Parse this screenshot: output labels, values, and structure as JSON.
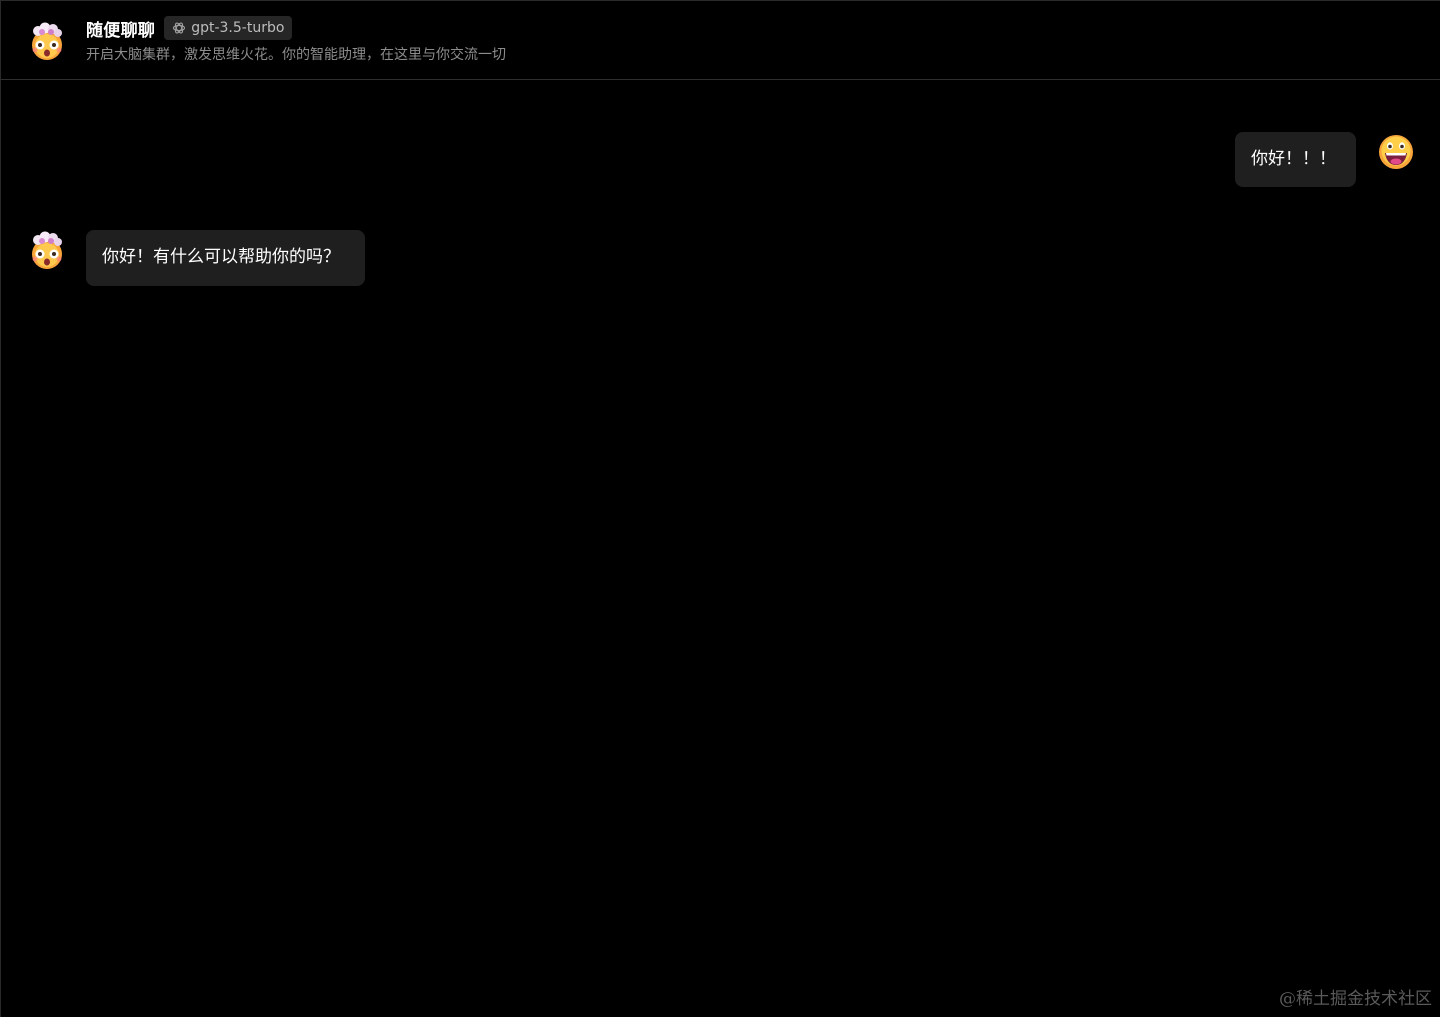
{
  "header": {
    "avatar_icon": "mind-blown-emoji-icon",
    "title": "随便聊聊",
    "model_icon": "openai-logo-icon",
    "model": "gpt-3.5-turbo",
    "subtitle": "开启大脑集群，激发思维火花。你的智能助理，在这里与你交流一切"
  },
  "messages": [
    {
      "role": "user",
      "avatar_icon": "grinning-face-emoji-icon",
      "text": "你好！！！"
    },
    {
      "role": "assistant",
      "avatar_icon": "mind-blown-emoji-icon",
      "text": "你好！有什么可以帮助你的吗？"
    }
  ],
  "watermark": "@稀土掘金技术社区",
  "colors": {
    "background": "#000000",
    "bubble": "#1f1f1f",
    "tag_background": "#262626",
    "subtitle": "#8c8c8c"
  }
}
